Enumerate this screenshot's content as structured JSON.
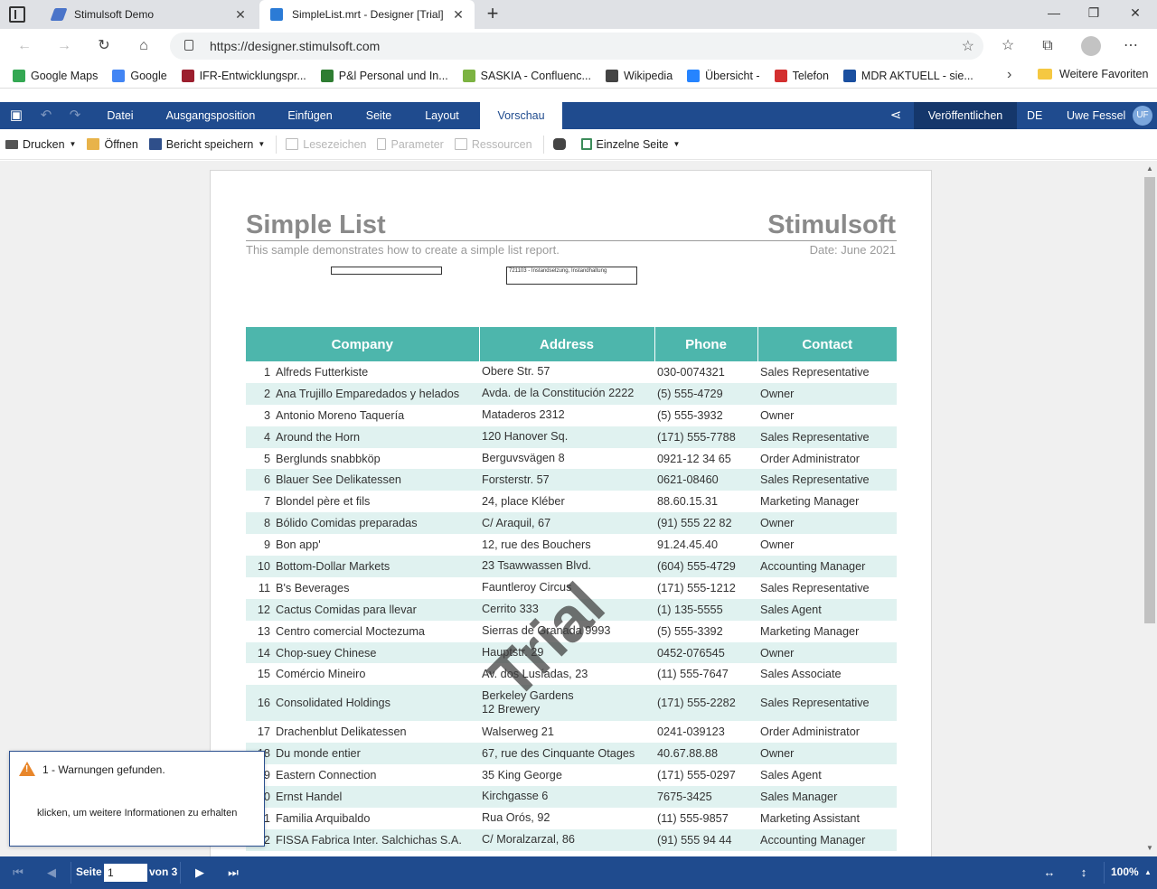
{
  "browser": {
    "tabs": [
      {
        "title": "Stimulsoft Demo",
        "active": false
      },
      {
        "title": "SimpleList.mrt - Designer [Trial]",
        "active": true
      }
    ],
    "url": "https://designer.stimulsoft.com",
    "bookmarks": [
      {
        "label": "Google Maps",
        "color": "#34a853"
      },
      {
        "label": "Google",
        "color": "#4285f4"
      },
      {
        "label": "IFR-Entwicklungspr...",
        "color": "#9c1f2e"
      },
      {
        "label": "P&l Personal und In...",
        "color": "#2e7d32"
      },
      {
        "label": "SASKIA - Confluenc...",
        "color": "#7cb342"
      },
      {
        "label": "Wikipedia",
        "color": "#444444"
      },
      {
        "label": "Übersicht -",
        "color": "#2684ff"
      },
      {
        "label": "Telefon",
        "color": "#d32f2f"
      },
      {
        "label": "MDR AKTUELL - sie...",
        "color": "#1a4fa0"
      }
    ],
    "favorites_folder": "Weitere Favoriten"
  },
  "menubar": {
    "items": [
      "Datei",
      "Ausgangsposition",
      "Einfügen",
      "Seite",
      "Layout",
      "Vorschau"
    ],
    "active": "Vorschau",
    "publish": "Veröffentlichen",
    "language": "DE",
    "user": "Uwe Fessel",
    "user_initials": "UF",
    "accent_color": "#1f4b8e"
  },
  "toolbar": {
    "print": "Drucken",
    "open": "Öffnen",
    "save": "Bericht speichern",
    "bookmarks": "Lesezeichen",
    "parameters": "Parameter",
    "resources": "Ressourcen",
    "view_mode": "Einzelne Seite"
  },
  "report": {
    "title": "Simple List",
    "brand": "Stimulsoft",
    "subtitle": "This sample demonstrates how to create a simple list report.",
    "date": "Date: June 2021",
    "box_text": "721103 - Instandsetzung, Instandhaltung",
    "watermark": "Trial",
    "columns": [
      "Company",
      "Address",
      "Phone",
      "Contact"
    ],
    "header_color": "#4db6ac",
    "rows": [
      {
        "n": "1",
        "company": "Alfreds Futterkiste",
        "address": "Obere Str. 57",
        "phone": "030-0074321",
        "contact": "Sales Representative"
      },
      {
        "n": "2",
        "company": "Ana Trujillo Emparedados y helados",
        "address": "Avda. de la Constitución 2222",
        "phone": "(5) 555-4729",
        "contact": "Owner"
      },
      {
        "n": "3",
        "company": "Antonio Moreno Taquería",
        "address": "Mataderos  2312",
        "phone": "(5) 555-3932",
        "contact": "Owner"
      },
      {
        "n": "4",
        "company": "Around the Horn",
        "address": "120 Hanover Sq.",
        "phone": "(171) 555-7788",
        "contact": "Sales Representative"
      },
      {
        "n": "5",
        "company": "Berglunds snabbköp",
        "address": "Berguvsvägen  8",
        "phone": "0921-12 34 65",
        "contact": "Order Administrator"
      },
      {
        "n": "6",
        "company": "Blauer See Delikatessen",
        "address": "Forsterstr. 57",
        "phone": "0621-08460",
        "contact": "Sales Representative"
      },
      {
        "n": "7",
        "company": "Blondel père et fils",
        "address": "24, place Kléber",
        "phone": "88.60.15.31",
        "contact": "Marketing Manager"
      },
      {
        "n": "8",
        "company": "Bólido Comidas preparadas",
        "address": "C/ Araquil, 67",
        "phone": "(91) 555 22 82",
        "contact": "Owner"
      },
      {
        "n": "9",
        "company": "Bon app'",
        "address": "12, rue des Bouchers",
        "phone": "91.24.45.40",
        "contact": "Owner"
      },
      {
        "n": "10",
        "company": "Bottom-Dollar Markets",
        "address": "23 Tsawwassen Blvd.",
        "phone": "(604) 555-4729",
        "contact": "Accounting Manager"
      },
      {
        "n": "11",
        "company": "B's Beverages",
        "address": "Fauntleroy Circus",
        "phone": "(171) 555-1212",
        "contact": "Sales Representative"
      },
      {
        "n": "12",
        "company": "Cactus Comidas para llevar",
        "address": "Cerrito 333",
        "phone": "(1) 135-5555",
        "contact": "Sales Agent"
      },
      {
        "n": "13",
        "company": "Centro comercial Moctezuma",
        "address": "Sierras de Granada 9993",
        "phone": "(5) 555-3392",
        "contact": "Marketing Manager"
      },
      {
        "n": "14",
        "company": "Chop-suey Chinese",
        "address": "Hauptstr. 29",
        "phone": "0452-076545",
        "contact": "Owner"
      },
      {
        "n": "15",
        "company": "Comércio Mineiro",
        "address": "Av. dos Lusíadas, 23",
        "phone": "(11) 555-7647",
        "contact": "Sales Associate"
      },
      {
        "n": "16",
        "company": "Consolidated Holdings",
        "address": "Berkeley Gardens",
        "address2": "12  Brewery",
        "phone": "(171) 555-2282",
        "contact": "Sales Representative"
      },
      {
        "n": "17",
        "company": "Drachenblut Delikatessen",
        "address": "Walserweg 21",
        "phone": "0241-039123",
        "contact": "Order Administrator"
      },
      {
        "n": "18",
        "company": "Du monde entier",
        "address": "67, rue des Cinquante Otages",
        "phone": "40.67.88.88",
        "contact": "Owner"
      },
      {
        "n": "19",
        "company": "Eastern Connection",
        "address": "35 King George",
        "phone": "(171) 555-0297",
        "contact": "Sales Agent"
      },
      {
        "n": "20",
        "company": "Ernst Handel",
        "address": "Kirchgasse 6",
        "phone": "7675-3425",
        "contact": "Sales Manager"
      },
      {
        "n": "21",
        "company": "Familia Arquibaldo",
        "address": "Rua Orós, 92",
        "phone": "(11) 555-9857",
        "contact": "Marketing Assistant"
      },
      {
        "n": "22",
        "company": "FISSA Fabrica Inter. Salchichas S.A.",
        "address": "C/ Moralzarzal, 86",
        "phone": "(91) 555 94 44",
        "contact": "Accounting Manager"
      }
    ]
  },
  "warning": {
    "title": "1 - Warnungen gefunden.",
    "link": "klicken, um weitere Informationen zu erhalten"
  },
  "statusbar": {
    "page_label": "Seite",
    "page_value": "1",
    "of_label": "von 3",
    "zoom": "100%"
  }
}
